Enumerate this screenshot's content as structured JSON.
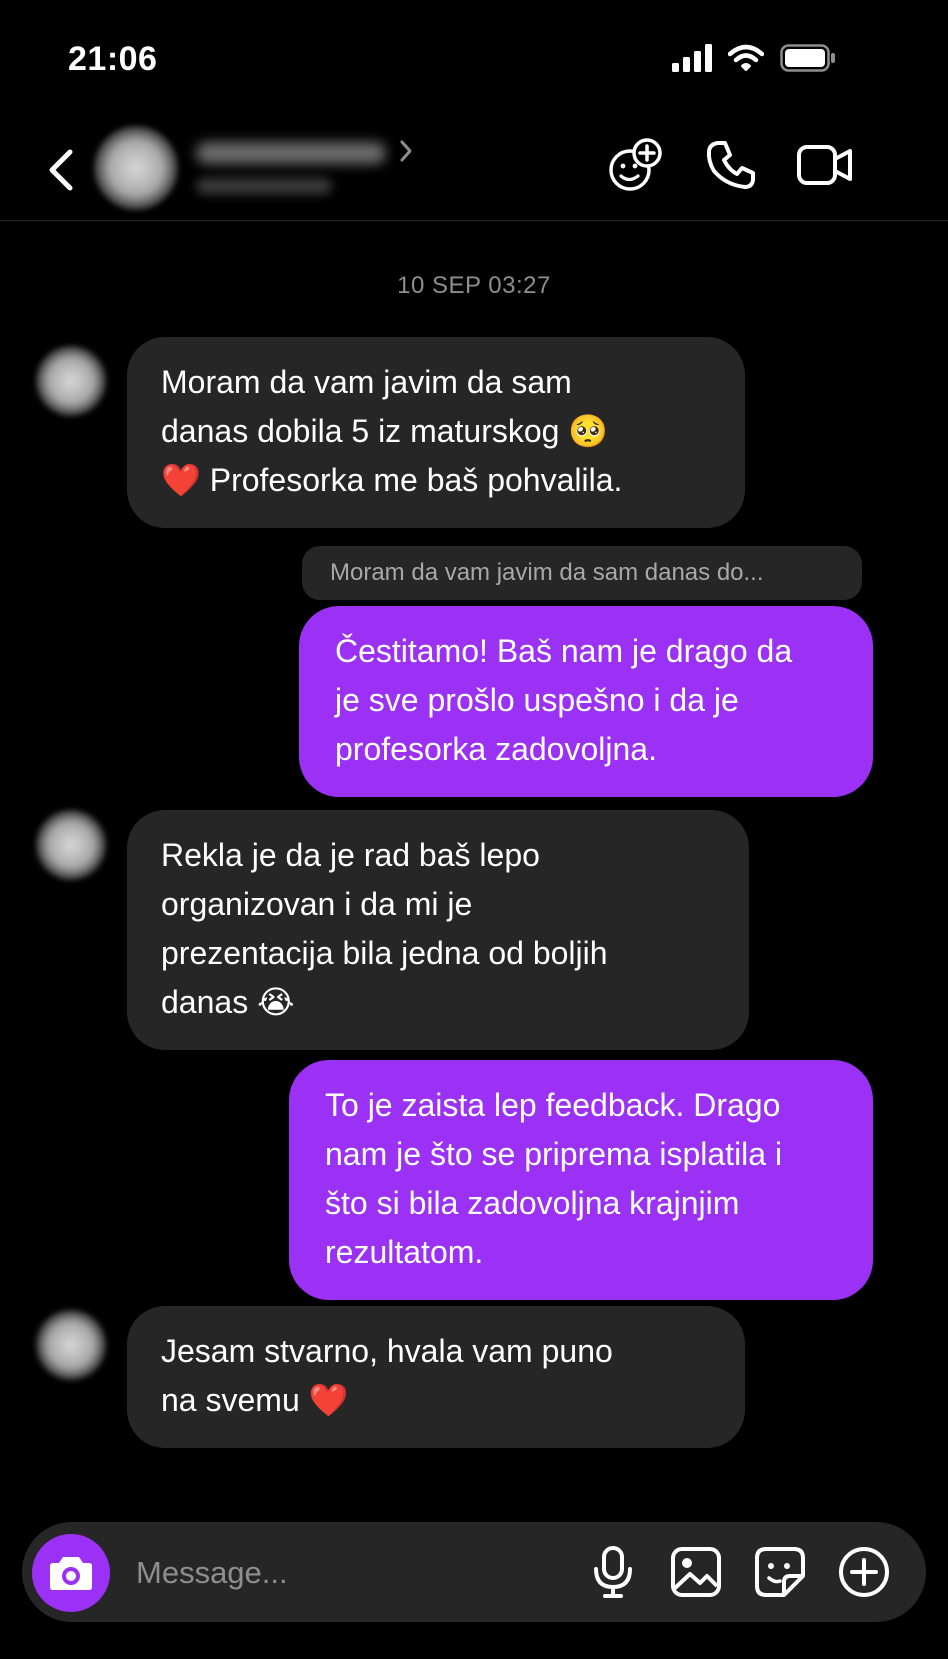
{
  "status_bar": {
    "time": "21:06"
  },
  "header": {
    "icons": [
      "back-icon",
      "chevron-right-icon",
      "add-people-icon",
      "phone-icon",
      "video-camera-icon"
    ]
  },
  "chat": {
    "timestamp": "10 SEP 03:27",
    "reply_preview": "Moram da vam javim da sam danas do...",
    "messages": [
      {
        "from": "them",
        "lines": [
          "Moram da vam javim da sam",
          "danas dobila 5 iz maturskog 🥺",
          "❤️  Profesorka me baš pohvalila."
        ]
      },
      {
        "from": "me",
        "lines": [
          "Čestitamo! Baš nam je drago da",
          "je sve prošlo uspešno i da je",
          "profesorka zadovoljna."
        ]
      },
      {
        "from": "them",
        "lines": [
          "Rekla je da je rad baš lepo",
          "organizovan i da mi je",
          "prezentacija bila jedna od boljih",
          "danas 😭"
        ]
      },
      {
        "from": "me",
        "lines": [
          "To je zaista lep feedback. Drago",
          "nam je što se priprema isplatila i",
          "što si bila zadovoljna krajnjim",
          "rezultatom."
        ]
      },
      {
        "from": "them",
        "lines": [
          "Jesam stvarno, hvala vam puno",
          "na svemu ❤️"
        ]
      }
    ]
  },
  "composer": {
    "placeholder": "Message...",
    "icons": [
      "camera-icon",
      "microphone-icon",
      "gallery-icon",
      "sticker-icon",
      "plus-icon"
    ]
  },
  "colors": {
    "background": "#000000",
    "received_bubble": "#262626",
    "sent_bubble": "#9b31f5",
    "secondary_text": "#8e8e8e"
  }
}
